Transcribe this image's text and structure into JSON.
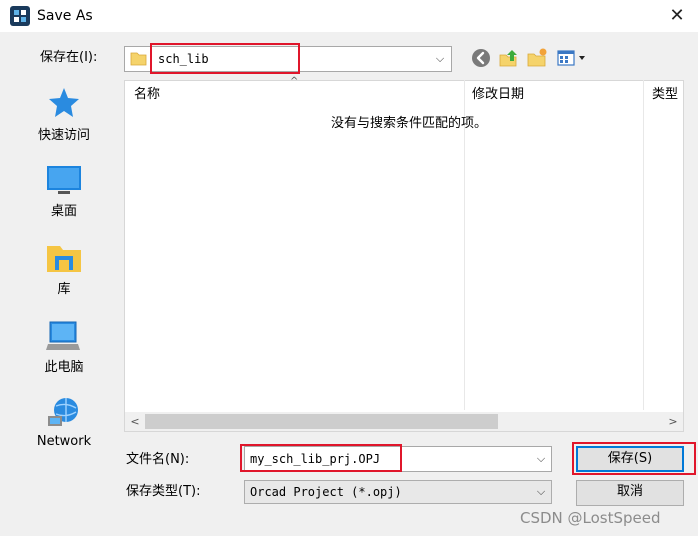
{
  "window": {
    "title": "Save As",
    "close_glyph": "✕"
  },
  "toolbar": {
    "save_in_label": "保存在(I):",
    "save_in_value": "sch_lib",
    "icons": [
      "back-icon",
      "up-folder-icon",
      "new-folder-icon",
      "view-menu-icon"
    ]
  },
  "places": [
    {
      "label": "快速访问",
      "icon": "star-icon"
    },
    {
      "label": "桌面",
      "icon": "desktop-icon"
    },
    {
      "label": "库",
      "icon": "library-icon"
    },
    {
      "label": "此电脑",
      "icon": "computer-icon"
    },
    {
      "label": "Network",
      "icon": "network-icon"
    }
  ],
  "filelist": {
    "columns": [
      "名称",
      "修改日期",
      "类型"
    ],
    "empty_message": "没有与搜索条件匹配的项。"
  },
  "form": {
    "filename_label": "文件名(N):",
    "filename_value": "my_sch_lib_prj.OPJ",
    "filetype_label": "保存类型(T):",
    "filetype_value": "Orcad Project (*.opj)"
  },
  "buttons": {
    "save_label": "保存(S)",
    "cancel_label": "取消"
  },
  "watermark": "CSDN @LostSpeed",
  "colors": {
    "highlight_red": "#e0162b",
    "focus_blue": "#0078d7"
  }
}
